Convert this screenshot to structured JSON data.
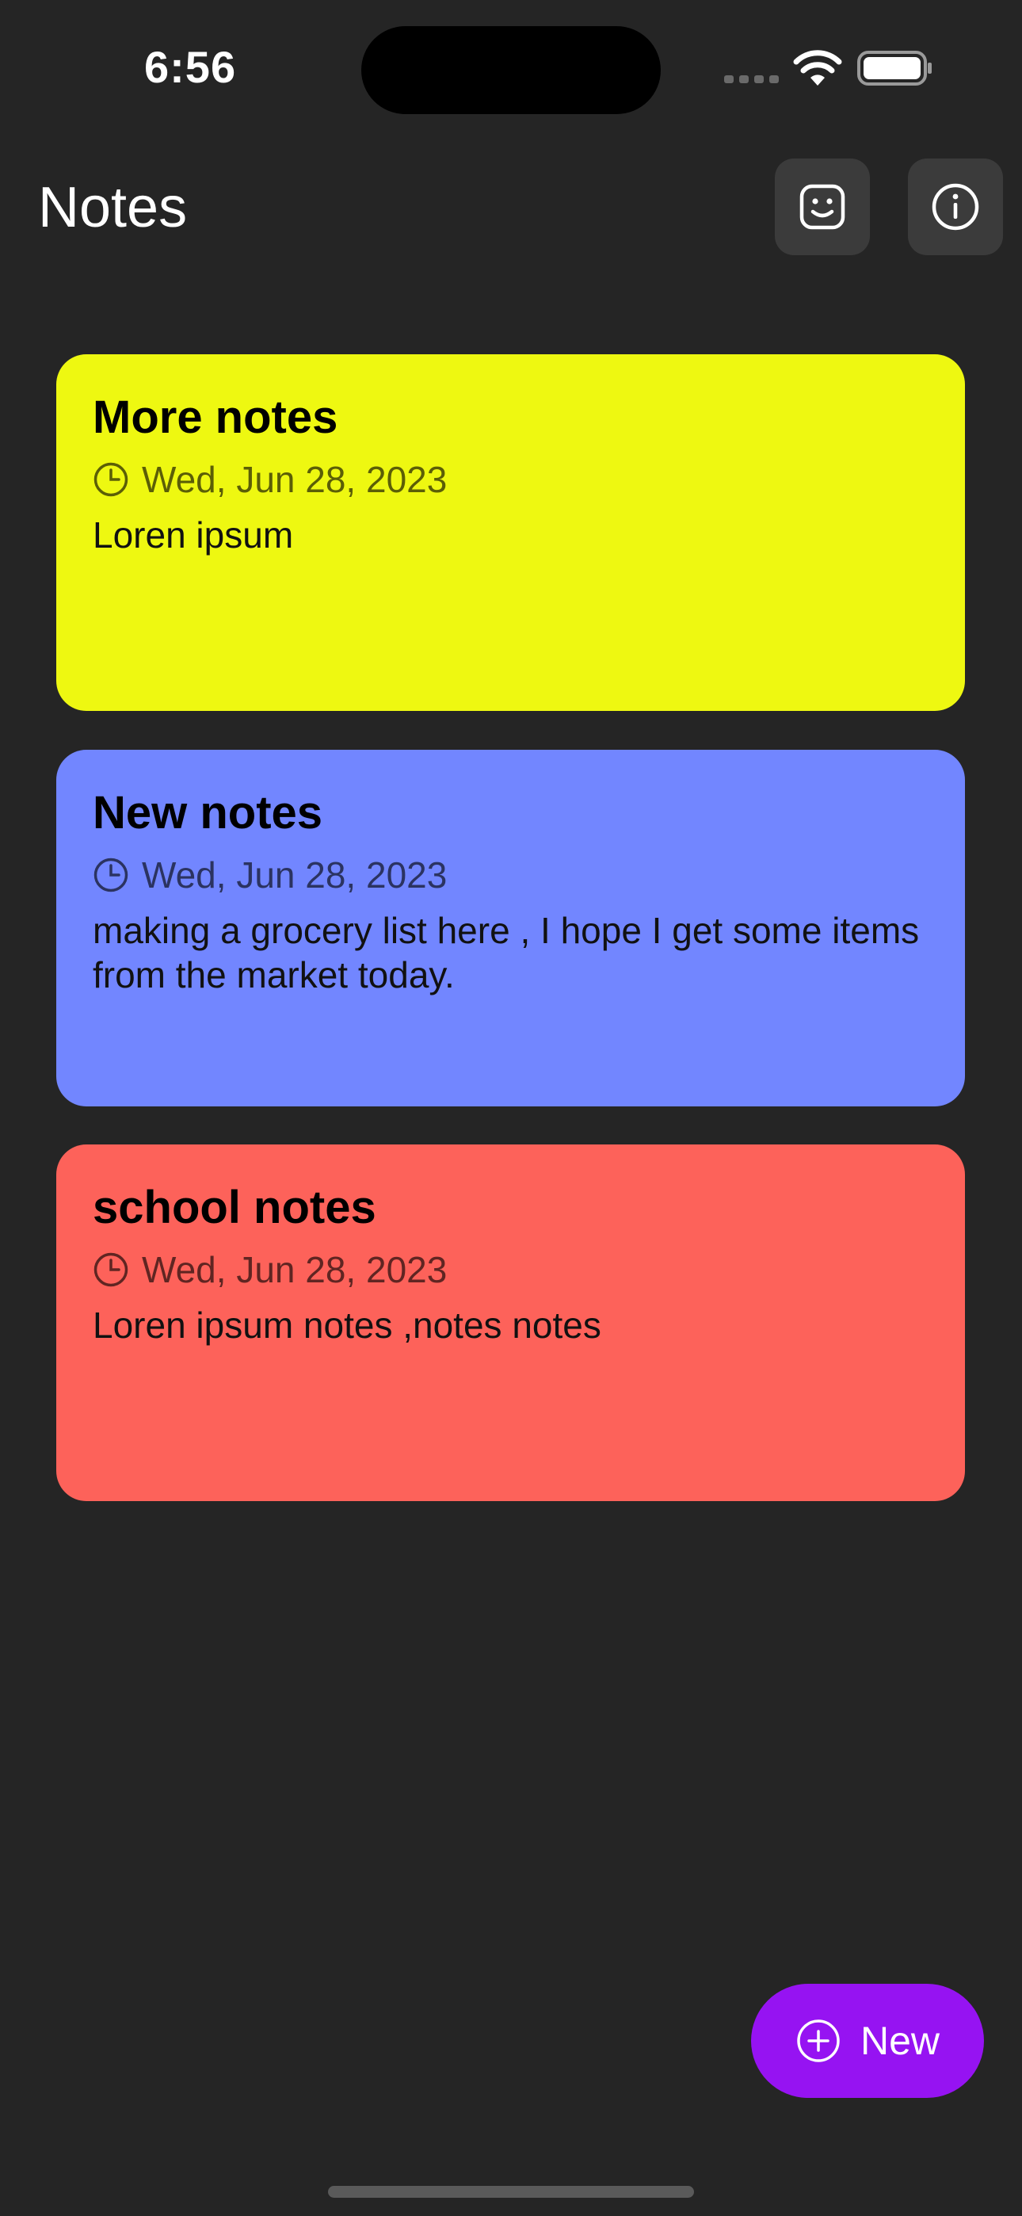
{
  "status_bar": {
    "time": "6:56"
  },
  "header": {
    "title": "Notes",
    "smile_button_icon": "smiley-face-icon",
    "info_button_icon": "info-icon"
  },
  "notes": [
    {
      "title": "More notes",
      "date": "Wed, Jun 28, 2023",
      "body": "Loren ipsum",
      "color": "#eef811"
    },
    {
      "title": "New notes",
      "date": "Wed, Jun 28, 2023",
      "body": "making a grocery list here , I hope I get some items from the market today.",
      "color": "#7286ff"
    },
    {
      "title": "school notes",
      "date": "Wed, Jun 28, 2023",
      "body": "Loren ipsum notes ,notes notes",
      "color": "#fd625a"
    }
  ],
  "fab": {
    "label": "New",
    "icon": "plus-circle-icon",
    "color": "#9613f2"
  },
  "colors": {
    "background": "#252525",
    "header_button_bg": "#3b3b3b"
  }
}
